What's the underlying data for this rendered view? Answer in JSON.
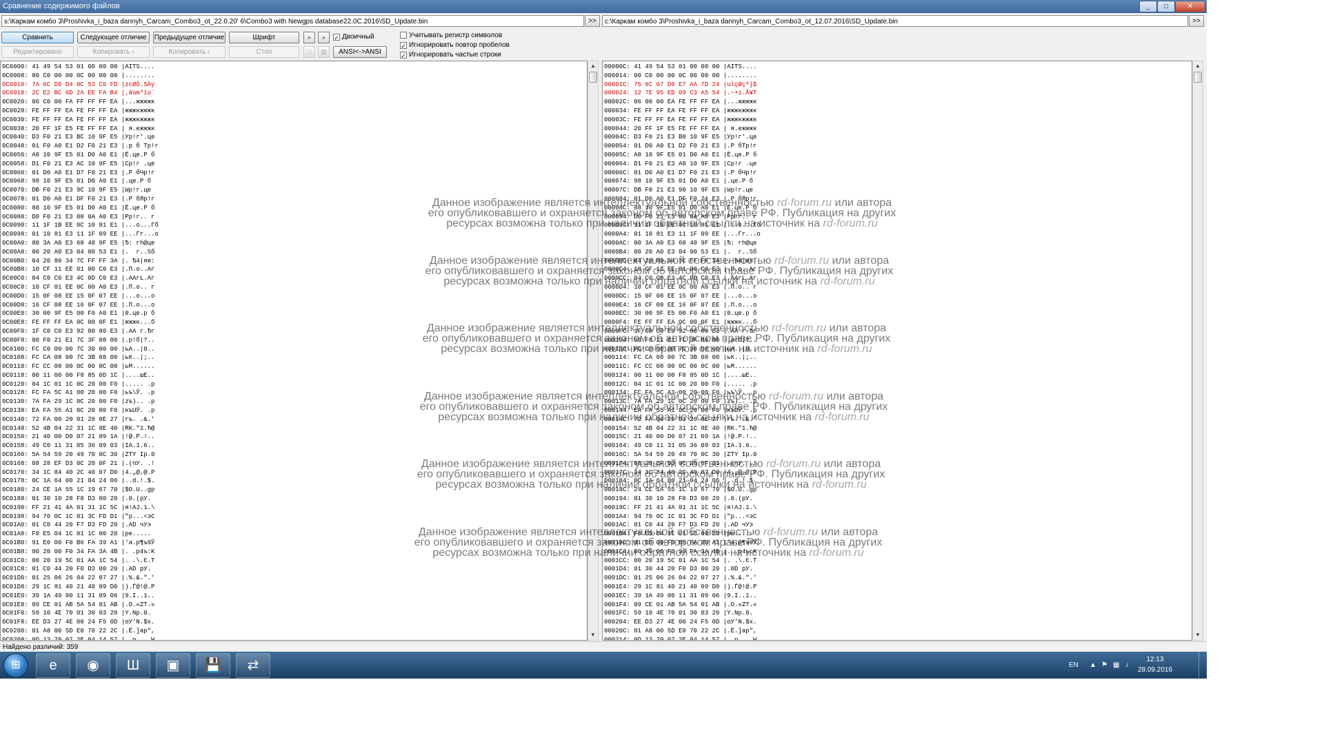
{
  "window": {
    "title": "Сравнение содержимого файлов",
    "minimize": "_",
    "maximize": "□",
    "close": "✕"
  },
  "paths": {
    "left": "s:\\Каркам комбо 3\\Proshivka_i_baza dannyh_Carcam_Combo3_ot_22.0.20' 6\\Combo3 with Newgps database22.0C.2016\\SD_Update.bin",
    "right": "c:\\Каркам комбо 3\\Proshivka_i_baza dannyh_Carcam_Combo3_ot_12.07.2016\\SD_Update.bin",
    "go_label": ">>"
  },
  "toolbar": {
    "compare": "Сравнить",
    "next_diff": "Следующее отличие",
    "prev_diff": "Предыдущее отличие",
    "font": "Шрифт",
    "edit": "Редактировано",
    "copy_right": "Копировать ›",
    "copy_left": "Копировать ‹",
    "stop": "Стоп",
    "ansi": "ANSI<->ANSI",
    "binary": "Двоичный",
    "binary_checked": "✓",
    "opt_case": "Учитывать регистр символов",
    "opt_repeat": "Игнорировать повтор пробелов",
    "opt_frequent": "Игнорировать частые строки",
    "opt_case_checked": "",
    "opt_repeat_checked": "✓",
    "opt_frequent_checked": "✓"
  },
  "scroll_icons": {
    "up": "▲",
    "down": "▼"
  },
  "left_lines": [
    {
      "text": "0C0000: 41 49 54 53 01 00 00 00 |AITS....",
      "state": "normal"
    },
    {
      "text": "0C0008: 00 C0 00 00 0C 00 00 00 |........",
      "state": "normal"
    },
    {
      "text": "0C0010: 7A 6C D8 D4 0C 53 C0 FD |zcØÔ.SÀý",
      "state": "diff"
    },
    {
      "text": "0C0018: 2C E2 BC 6D 2A EE FA B4 |,â¼m*îú´",
      "state": "diff"
    },
    {
      "text": "0C0020: 06 C0 00 FA FF FF FF EA |...жжжжк",
      "state": "normal"
    },
    {
      "text": "0C0028: FE FF FF EA FE FF FF EA |жжжкжжжк",
      "state": "normal"
    },
    {
      "text": "0C0030: FE FF FF EA FE FF FF EA |жжжкжжжк",
      "state": "normal"
    },
    {
      "text": "0C0038: 20 FF 1F E5 FE FF FF EA | я.ежжжк",
      "state": "normal"
    },
    {
      "text": "0C0040: D3 F0 21 E3 BC 10 9F E5 |Ур!г'.це",
      "state": "normal"
    },
    {
      "text": "0C0048: 01 F0 A0 E1 D2 F0 21 E3 |.р б Тр!г",
      "state": "normal"
    },
    {
      "text": "0C0050: A8 10 9F E5 01 D0 A0 E1 |Ё.це.Р б",
      "state": "normal"
    },
    {
      "text": "0C0058: D1 F0 21 E3 AC 10 9F E5 |Ср!г .це",
      "state": "normal"
    },
    {
      "text": "0C0060: 01 D0 A0 E1 D7 F0 21 E3 |.Р бЧр!г",
      "state": "normal"
    },
    {
      "text": "0C0068: 98 10 9F E5 01 D0 A0 E1 |.це.Р б",
      "state": "normal"
    },
    {
      "text": "0C0070: DB F0 21 E3 9C 10 9F E5 |Ыр!г.це",
      "state": "normal"
    },
    {
      "text": "0C0078: 01 D0 A0 E1 DF F0 21 E3 |.Р бЯр!г",
      "state": "normal"
    },
    {
      "text": "0C0080: 88 10 9F E5 01 D0 A0 E1 |Ё.це.Р б",
      "state": "normal"
    },
    {
      "text": "0C0088: D0 F0 21 E3 00 0A A0 E3 |Рр!г.. г",
      "state": "normal"
    },
    {
      "text": "0C0090: 11 1F 1B EE 0C 10 81 E1 |...о...Гб",
      "state": "normal"
    },
    {
      "text": "0C0098: 01 10 81 E3 11 1F 09 EE |...Гг...о",
      "state": "normal"
    },
    {
      "text": "0C00A0: 80 3A A0 E3 68 40 9F E5 |Ђ: гh@це",
      "state": "normal"
    },
    {
      "text": "0C00A8: 00 20 A0 E3 04 00 53 E1 |.  г..Sб",
      "state": "normal"
    },
    {
      "text": "0C00B0: 04 20 80 34 7C FF FF 3A |. Ђ4|яя:",
      "state": "normal"
    },
    {
      "text": "0C00B8: 10 CF 11 EE 01 00 C0 E3 |.П.о..Аг",
      "state": "normal"
    },
    {
      "text": "0C00C0: 04 C0 C0 E3 4C 0D C0 E3 |.ААгL.Аг",
      "state": "normal"
    },
    {
      "text": "0C00C8: 10 CF 01 EE 0C 00 A0 E3 |.П.о.. г",
      "state": "normal"
    },
    {
      "text": "0C00D0: 15 0F 08 EE 15 0F 07 EE |...о...о",
      "state": "normal"
    },
    {
      "text": "0C00D8: 16 CF 08 EE 16 0F 07 EE |.П.о...о",
      "state": "normal"
    },
    {
      "text": "0C00E0: 30 00 9F E5 00 F0 A0 E1 |0.це.р б",
      "state": "normal"
    },
    {
      "text": "0C00E8: FE FF FF EA 0C 00 0F E1 |жжжк...б",
      "state": "normal"
    },
    {
      "text": "0C00F0: 1F C0 C0 E3 92 00 80 E3 |.АА г.Ђг",
      "state": "normal"
    },
    {
      "text": "0C00F8: 00 F0 21 E1 7C 3F 08 00 |.р!б|?..",
      "state": "normal"
    },
    {
      "text": "0C0100: FC C0 00 00 7C 30 00 00 |ьА..|0..",
      "state": "normal"
    },
    {
      "text": "0C0108: FC CA 08 00 7C 3B 08 00 |ьК..|;..",
      "state": "normal"
    },
    {
      "text": "0C0110: FC CC 08 00 0C 00 0C 00 |ьМ......",
      "state": "normal"
    },
    {
      "text": "0C0118: 00 11 00 00 F8 85 0D 1C |....шЕ..",
      "state": "normal"
    },
    {
      "text": "0C0120: 04 1C 01 1C 0C 20 00 F0 |..... .р",
      "state": "normal"
    },
    {
      "text": "0C0128: FC FA 5C A1 00 20 00 F0 |ьъ\\Ў. .р",
      "state": "normal"
    },
    {
      "text": "0C0130: 7A FA 29 1C 0C 20 00 F0 |zъ).. .р",
      "state": "normal"
    },
    {
      "text": "0C0138: EA FA 55 A1 0C 20 00 F0 |къUЎ. .р",
      "state": "normal"
    },
    {
      "text": "0C0140: 72 FA 00 20 01 26 0E 27 |rъ. .&.'",
      "state": "normal"
    },
    {
      "text": "0C0148: 52 4B 04 22 31 1C 8E 40 |RK.\"1.Ћ@",
      "state": "normal"
    },
    {
      "text": "0C0150: 21 40 00 D0 07 21 09 1A |!@.Р.!..",
      "state": "normal"
    },
    {
      "text": "0C0158: 49 C0 11 31 05 36 09 03 |IА.1.6..",
      "state": "normal"
    },
    {
      "text": "0C0160: 5A 54 59 20 49 70 0C 30 |ZTY Ip.0",
      "state": "normal"
    },
    {
      "text": "0C0168: 08 28 EF D3 0C 20 0F 21 |.(пУ. .!",
      "state": "normal"
    },
    {
      "text": "0C0170: 34 1C 84 40 2C 40 07 D0 |4.„@,@.Р",
      "state": "normal"
    },
    {
      "text": "0C0178: 0C 1A 64 00 21 04 24 06 |..d.!.$.",
      "state": "normal"
    },
    {
      "text": "0C0180: 24 CE 1A 55 1C 19 67 70 |$О.U..gp",
      "state": "normal"
    },
    {
      "text": "0C0188: 01 30 10 28 F0 D3 00 20 |.0.(рУ. ",
      "state": "normal"
    },
    {
      "text": "0C0190: FF 21 41 4A 01 31 1C 5C |я!AJ.1.\\",
      "state": "normal"
    },
    {
      "text": "0C0198: 94 70 0C 1C 01 3C FD D1 |”p...<эС",
      "state": "normal"
    },
    {
      "text": "0C01A0: 01 C0 44 20 F7 D3 FD 20 |.АD чУэ ",
      "state": "normal"
    },
    {
      "text": "0C01A8: F0 E5 04 1C 01 1C 00 20 |ре..... ",
      "state": "normal"
    },
    {
      "text": "0C01B0: 91 E0 00 F0 B6 FA 39 A1 |‘а.р¶ъ9Ў",
      "state": "normal"
    },
    {
      "text": "0C01B8: 00 20 00 F0 34 FA 3A 4B |. .р4ъ:K",
      "state": "normal"
    },
    {
      "text": "0C01C0: 00 20 19 5C 01 AA 1C 54 |. .\\.Є.T",
      "state": "normal"
    },
    {
      "text": "0C01C8: 01 C0 44 20 F0 D3 00 20 |.АD рУ. ",
      "state": "normal"
    },
    {
      "text": "0C01D0: 01 25 06 26 04 22 07 27 |.%.&.\".'",
      "state": "normal"
    },
    {
      "text": "0C01D8: 29 1C 81 40 21 40 09 D0 |).Ѓ@!@.Р",
      "state": "normal"
    },
    {
      "text": "0C01E0: 39 1A 49 00 11 31 09 06 |9.I..1..",
      "state": "normal"
    },
    {
      "text": "0C01E8: 09 CE 01 AB 5A 54 01 AB |.О.«ZT.«",
      "state": "normal"
    },
    {
      "text": "0C01F0: 59 10 4E 70 01 30 03 20 |Y.Np.0. ",
      "state": "normal"
    },
    {
      "text": "0C01F8: EE D3 27 4E 00 24 F5 0D |оУ'N.$х.",
      "state": "normal"
    },
    {
      "text": "0C0200: 01 A8 00 5D E0 70 22 2C |.Ё.]аp\",",
      "state": "normal"
    },
    {
      "text": "0C0208: 0D 13 70 07 2E 04 14 57 |..p....W",
      "state": "normal"
    }
  ],
  "right_lines": [
    {
      "text": "00000C: 41 49 54 53 01 00 00 00 |AITS....",
      "state": "normal"
    },
    {
      "text": "000014: 00 C0 00 00 0C 00 00 00 |........",
      "state": "normal"
    },
    {
      "text": "00001C: 75 6C 07 D8 E7 AA 7D 24 |ulçØçª}$",
      "state": "diff"
    },
    {
      "text": "000024: 12 7E 95 ED 09 C3 A5 54 |.~•í.Ã¥T",
      "state": "diff"
    },
    {
      "text": "00002C: 06 00 00 EA FE FF FF EA |...жжжжк",
      "state": "normal"
    },
    {
      "text": "000034: FE FF FF EA FE FF FF EA |жжжкжжжк",
      "state": "normal"
    },
    {
      "text": "00003C: FE FF FF EA FE FF FF EA |жжжкжжжк",
      "state": "normal"
    },
    {
      "text": "000044: 20 FF 1F E5 FE FF FF EA | я.ежжжк",
      "state": "normal"
    },
    {
      "text": "00004C: D3 F0 21 E3 B0 10 9F E5 |Ур!г'.це",
      "state": "normal"
    },
    {
      "text": "000054: 01 D0 A0 E1 D2 F0 21 E3 |.Р бТр!г",
      "state": "normal"
    },
    {
      "text": "00005C: A8 10 9F E5 01 D0 A0 E1 |Ё.це.Р б",
      "state": "normal"
    },
    {
      "text": "000064: D1 F0 21 E3 A0 10 9F E5 |Ср!г .це",
      "state": "normal"
    },
    {
      "text": "00006C: 01 D0 A0 E1 D7 F0 21 E3 |.Р бЧр!г",
      "state": "normal"
    },
    {
      "text": "000074: 98 10 9F E5 01 D0 A0 E1 |.це.Р б",
      "state": "normal"
    },
    {
      "text": "00007C: DB F0 21 E3 90 10 9F E5 |Ыр!г.це",
      "state": "normal"
    },
    {
      "text": "000084: 01 D0 A0 E1 DF F0 21 E3 |.Р бЯр!г",
      "state": "normal"
    },
    {
      "text": "00008C: 88 10 9F E5 01 D0 A0 E1 |Ё.це.Р б",
      "state": "normal"
    },
    {
      "text": "000094: D0 F0 21 E3 00 0A A0 E3 |Рр!г.. г",
      "state": "normal"
    },
    {
      "text": "00009C: 11 1F 1B EE 0C 10 81 E1 |...о...Гб",
      "state": "normal"
    },
    {
      "text": "0000A4: 01 10 81 E3 11 1F 09 EE |...Гг...о",
      "state": "normal"
    },
    {
      "text": "0000AC: 80 3A A0 E3 68 40 9F E5 |Ђ: гh@це",
      "state": "normal"
    },
    {
      "text": "0000B4: 00 20 A0 E3 04 00 53 E1 |.  г..Sб",
      "state": "normal"
    },
    {
      "text": "0000BC: 04 20 80 34 7C FF FF 3A |. Ђ4|яя:",
      "state": "normal"
    },
    {
      "text": "0000C4: 10 CF 11 EE 01 00 C0 E3 |.П.о..Аг",
      "state": "normal"
    },
    {
      "text": "0000CC: 04 C0 C0 E3 4C 0D C0 E3 |.ААгL.Аг",
      "state": "normal"
    },
    {
      "text": "0000D4: 10 CF 01 EE 0C 00 A0 E3 |.П.о.. г",
      "state": "normal"
    },
    {
      "text": "0000DC: 15 0F 08 EE 15 0F 07 EE |...о...о",
      "state": "normal"
    },
    {
      "text": "0000E4: 16 CF 08 EE 16 0F 07 EE |.П.о...о",
      "state": "normal"
    },
    {
      "text": "0000EC: 30 00 9F E5 00 F0 A0 E1 |0.це.р б",
      "state": "normal"
    },
    {
      "text": "0000F4: FE FF FF EA 0C 00 0F E1 |жжжк...б",
      "state": "normal"
    },
    {
      "text": "0000FC: 1F C0 C0 E3 92 00 80 E3 |.АА г.Ђг",
      "state": "normal"
    },
    {
      "text": "000104: 00 F0 21 E1 7C 3F 08 00 |.р!б|?..",
      "state": "normal"
    },
    {
      "text": "00010C: FC C0 00 00 7C 30 00 00 |ьА..|0..",
      "state": "normal"
    },
    {
      "text": "000114: FC CA 08 00 7C 3B 08 00 |ьК..|;..",
      "state": "normal"
    },
    {
      "text": "00011C: FC CC 08 00 0C 00 0C 00 |ьМ......",
      "state": "normal"
    },
    {
      "text": "000124: 00 11 00 00 F8 85 0D 1C |....шЕ..",
      "state": "normal"
    },
    {
      "text": "00012C: 04 1C 01 1C 00 20 00 F0 |..... .р",
      "state": "normal"
    },
    {
      "text": "000134: FC FA 5C A1 00 20 00 F0 |ьъ\\Ў. .р",
      "state": "normal"
    },
    {
      "text": "00013C: 7A FA 29 1C 0C 20 00 F0 |zъ).. .р",
      "state": "normal"
    },
    {
      "text": "000144: EA FA 55 A1 0C 20 00 F0 |къUЎ. .р",
      "state": "normal"
    },
    {
      "text": "00014C: 72 FA 00 20 01 26 0E 27 |rъ. .&.'",
      "state": "normal"
    },
    {
      "text": "000154: 52 4B 04 22 31 1C 8E 40 |RK.\"1.Ћ@",
      "state": "normal"
    },
    {
      "text": "00015C: 21 40 00 D0 07 21 09 1A |!@.Р.!..",
      "state": "normal"
    },
    {
      "text": "000164: 49 C0 11 31 05 36 09 03 |IА.1.6..",
      "state": "normal"
    },
    {
      "text": "00016C: 5A 54 59 20 49 70 0C 30 |ZTY Ip.0",
      "state": "normal"
    },
    {
      "text": "000174: 08 28 EF D3 0C 20 0F 21 |.(пУ. .!",
      "state": "normal"
    },
    {
      "text": "00017C: 34 1C 84 40 2C 40 07 D0 |4.„@,@.Р",
      "state": "normal"
    },
    {
      "text": "000184: 0C 1A 64 00 21 04 24 06 |..d.!.$.",
      "state": "normal"
    },
    {
      "text": "00018C: 24 CE 1A 55 1C 19 67 70 |$О.U..gp",
      "state": "normal"
    },
    {
      "text": "000194: 01 30 10 28 F0 D3 00 20 |.0.(рУ. ",
      "state": "normal"
    },
    {
      "text": "00019C: FF 21 41 4A 01 31 1C 5C |я!AJ.1.\\",
      "state": "normal"
    },
    {
      "text": "0001A4: 94 70 0C 1C 01 3C FD D1 |”p...<эС",
      "state": "normal"
    },
    {
      "text": "0001AC: 01 C0 44 20 F7 D3 FD 20 |.АD чУэ ",
      "state": "normal"
    },
    {
      "text": "0001B4: F0 E5 04 1C 01 1C 00 20 |ре..... ",
      "state": "normal"
    },
    {
      "text": "0001BC: 91 E0 00 F0 B6 FA 39 A1 |‘а.р¶ъ9Ў",
      "state": "normal"
    },
    {
      "text": "0001C4: 00 20 00 F0 34 FA 3A 4B |. .р4ъ:K",
      "state": "normal"
    },
    {
      "text": "0001CC: 00 20 19 5C 01 AA 1C 54 |. .\\.Є.T",
      "state": "normal"
    },
    {
      "text": "0001D4: 01 30 44 20 F0 D3 00 20 |.0D рУ. ",
      "state": "normal"
    },
    {
      "text": "0001DC: 01 25 06 26 04 22 07 27 |.%.&.\".'",
      "state": "normal"
    },
    {
      "text": "0001E4: 29 1C 81 40 21 40 09 D0 |).Ѓ@!@.Р",
      "state": "normal"
    },
    {
      "text": "0001EC: 39 1A 49 00 11 31 09 06 |9.I..1..",
      "state": "normal"
    },
    {
      "text": "0001F4: 09 CE 01 AB 5A 54 01 AB |.О.«ZT.«",
      "state": "normal"
    },
    {
      "text": "0001FC: 59 10 4E 70 01 30 03 20 |Y.Np.0. ",
      "state": "normal"
    },
    {
      "text": "000204: EE D3 27 4E 00 24 F5 0D |оУ'N.$х.",
      "state": "normal"
    },
    {
      "text": "00020C: 01 A8 00 5D E0 70 22 2C |.Ё.]аp\",",
      "state": "normal"
    },
    {
      "text": "000214: 0D 13 70 07 2E 04 14 57 |..p....W",
      "state": "normal"
    }
  ],
  "watermark": {
    "line1_pre": "Данное изображение является интеллектуальной собственностью",
    "site": "rd-forum.ru",
    "line1_post": "или автора",
    "line2": "его опубликовавшего и охраняется законом об авторском праве РФ. Публикация на других",
    "line3_pre": "ресурсах возможна только при наличии обратной ссылки на источник на"
  },
  "status": {
    "text": "Найдено различий: 359"
  },
  "taskbar": {
    "start_glyph": "⊞",
    "items": [
      {
        "name": "ie-task",
        "glyph": "e"
      },
      {
        "name": "chrome-task",
        "glyph": "◉"
      },
      {
        "name": "app-task-orange",
        "glyph": "Ш"
      },
      {
        "name": "app-task-monitor",
        "glyph": "▣"
      },
      {
        "name": "app-task-floppy",
        "glyph": "💾"
      },
      {
        "name": "compare-task",
        "glyph": "⇄"
      }
    ],
    "lang": "EN",
    "time": "12:13",
    "date": "28.09.2016"
  }
}
